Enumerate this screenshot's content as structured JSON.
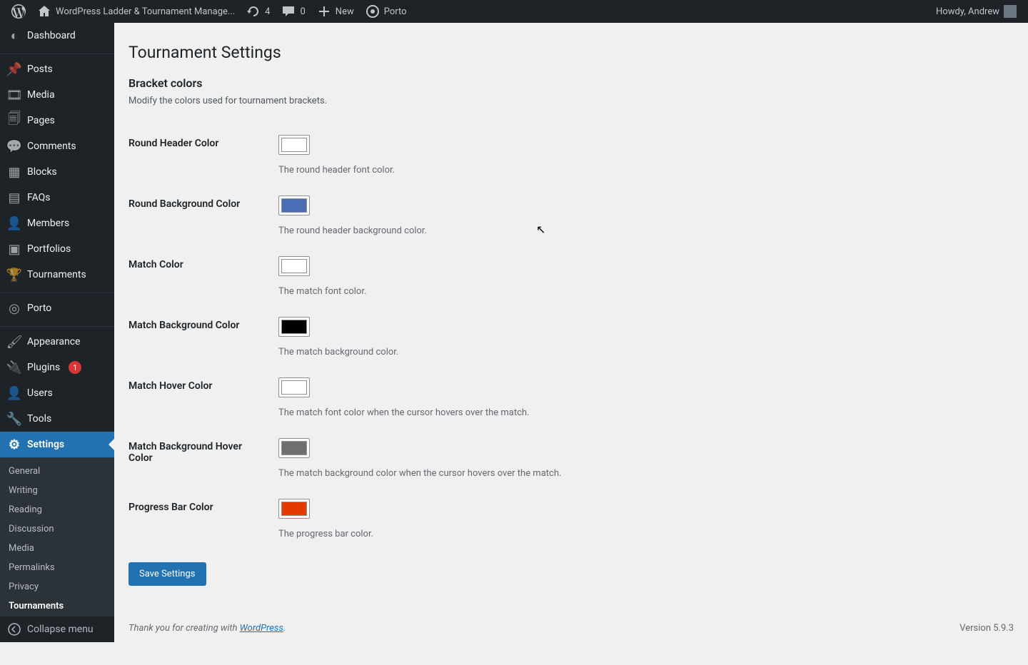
{
  "adminbar": {
    "site_name": "WordPress Ladder & Tournament Manage...",
    "updates_count": "4",
    "comments_count": "0",
    "new_label": "New",
    "porto_label": "Porto",
    "howdy": "Howdy, Andrew"
  },
  "sidebar": {
    "items": [
      {
        "label": "Dashboard",
        "icon": "dashboard"
      },
      {
        "label": "Posts",
        "icon": "pin"
      },
      {
        "label": "Media",
        "icon": "media"
      },
      {
        "label": "Pages",
        "icon": "page"
      },
      {
        "label": "Comments",
        "icon": "comment"
      },
      {
        "label": "Blocks",
        "icon": "block"
      },
      {
        "label": "FAQs",
        "icon": "book"
      },
      {
        "label": "Members",
        "icon": "user"
      },
      {
        "label": "Portfolios",
        "icon": "portfolio"
      },
      {
        "label": "Tournaments",
        "icon": "trophy"
      },
      {
        "label": "Porto",
        "icon": "circle"
      },
      {
        "label": "Appearance",
        "icon": "brush"
      },
      {
        "label": "Plugins",
        "icon": "plug",
        "badge": "1"
      },
      {
        "label": "Users",
        "icon": "user"
      },
      {
        "label": "Tools",
        "icon": "wrench"
      },
      {
        "label": "Settings",
        "icon": "settings",
        "current": true
      }
    ],
    "submenu": [
      {
        "label": "General"
      },
      {
        "label": "Writing"
      },
      {
        "label": "Reading"
      },
      {
        "label": "Discussion"
      },
      {
        "label": "Media"
      },
      {
        "label": "Permalinks"
      },
      {
        "label": "Privacy"
      },
      {
        "label": "Tournaments",
        "current": true
      }
    ],
    "collapse_label": "Collapse menu"
  },
  "page": {
    "title": "Tournament Settings",
    "section_title": "Bracket colors",
    "section_desc": "Modify the colors used for tournament brackets.",
    "fields": [
      {
        "label": "Round Header Color",
        "color": "#ffffff",
        "desc": "The round header font color."
      },
      {
        "label": "Round Background Color",
        "color": "#4a6db5",
        "desc": "The round header background color."
      },
      {
        "label": "Match Color",
        "color": "#ffffff",
        "desc": "The match font color."
      },
      {
        "label": "Match Background Color",
        "color": "#000000",
        "desc": "The match background color."
      },
      {
        "label": "Match Hover Color",
        "color": "#ffffff",
        "desc": "The match font color when the cursor hovers over the match."
      },
      {
        "label": "Match Background Hover Color",
        "color": "#707070",
        "desc": "The match background color when the cursor hovers over the match."
      },
      {
        "label": "Progress Bar Color",
        "color": "#e53900",
        "desc": "The progress bar color."
      }
    ],
    "save_label": "Save Settings"
  },
  "footer": {
    "thanks_prefix": "Thank you for creating with ",
    "link_text": "WordPress",
    "thanks_suffix": ".",
    "version": "Version 5.9.3"
  },
  "icons": {
    "dashboard": "◐",
    "pin": "📌",
    "media": "🎞",
    "page": "🗐",
    "comment": "💬",
    "block": "▦",
    "book": "▤",
    "user": "👤",
    "portfolio": "▣",
    "trophy": "🏆",
    "circle": "◎",
    "brush": "🖌",
    "plug": "🔌",
    "wrench": "🔧",
    "settings": "⚙"
  }
}
